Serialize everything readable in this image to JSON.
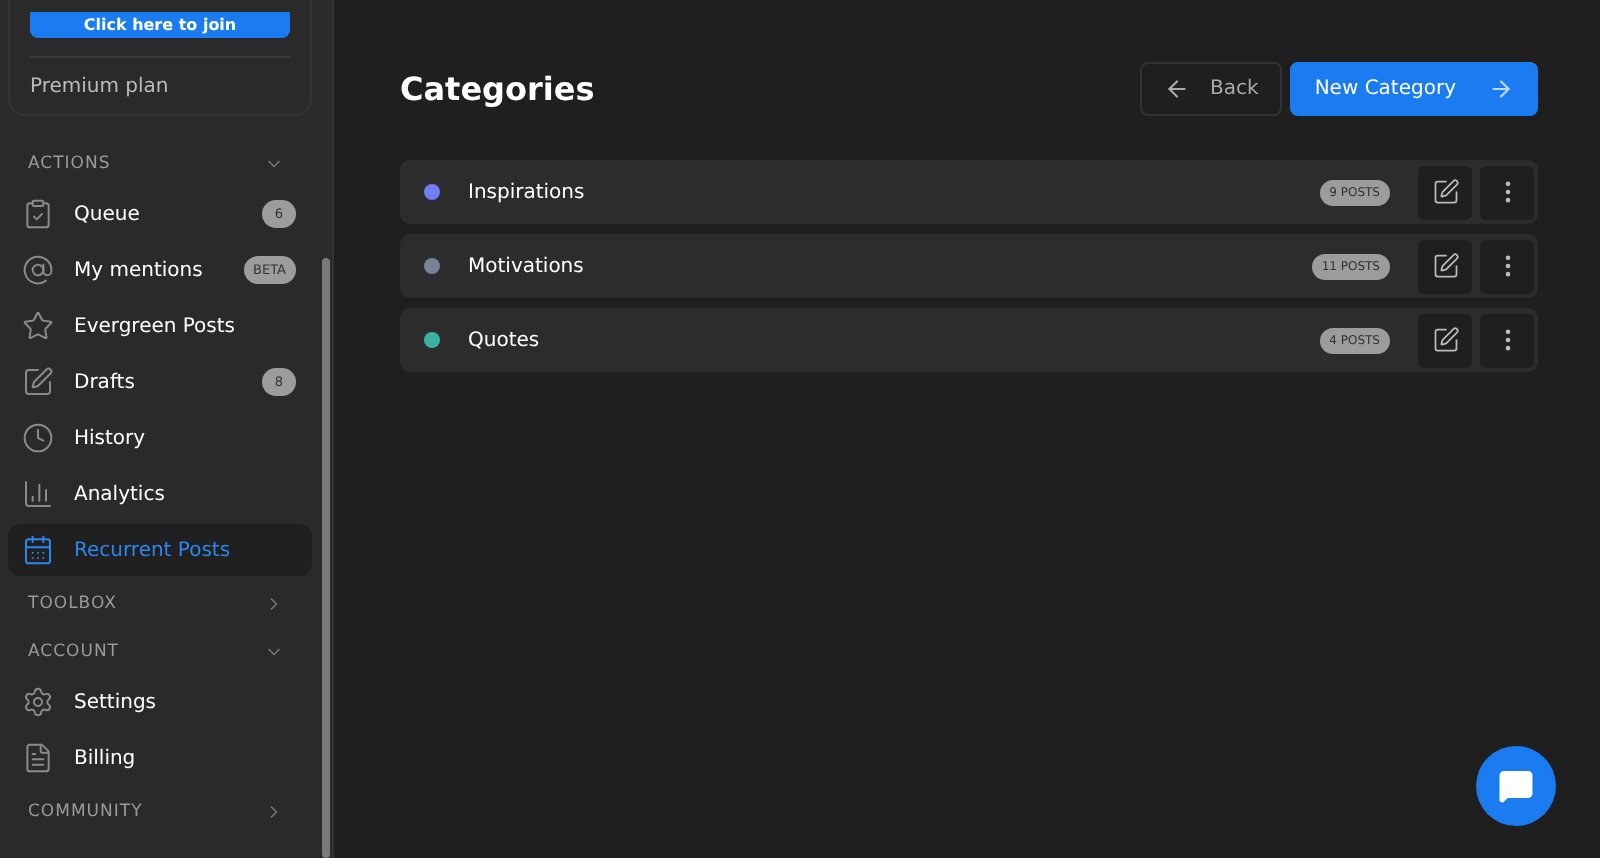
{
  "sidebar": {
    "join_button": "Click here to join",
    "plan": "Premium plan",
    "sections": [
      {
        "title": "ACTIONS",
        "expanded": true,
        "items": [
          {
            "label": "Queue",
            "badge": "6",
            "selected": false
          },
          {
            "label": "My mentions",
            "badge": "BETA",
            "selected": false
          },
          {
            "label": "Evergreen Posts",
            "selected": false
          },
          {
            "label": "Drafts",
            "badge": "8",
            "selected": false
          },
          {
            "label": "History",
            "selected": false
          },
          {
            "label": "Analytics",
            "selected": false
          },
          {
            "label": "Recurrent Posts",
            "selected": true
          }
        ]
      },
      {
        "title": "TOOLBOX",
        "expanded": false
      },
      {
        "title": "ACCOUNT",
        "expanded": true,
        "items": [
          {
            "label": "Settings",
            "selected": false
          },
          {
            "label": "Billing",
            "selected": false
          }
        ]
      },
      {
        "title": "COMMUNITY",
        "expanded": false
      }
    ]
  },
  "page": {
    "title": "Categories",
    "back_button": "Back",
    "new_button": "New Category"
  },
  "categories": [
    {
      "name": "Inspirations",
      "color": "#6f7ef0",
      "count": "9 POSTS"
    },
    {
      "name": "Motivations",
      "color": "#7b8196",
      "count": "11 POSTS"
    },
    {
      "name": "Quotes",
      "color": "#3bb3a3",
      "count": "4 POSTS"
    }
  ]
}
